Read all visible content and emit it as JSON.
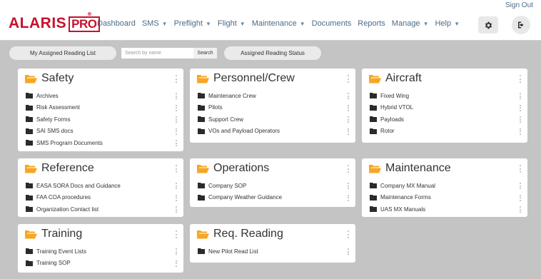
{
  "header": {
    "logo_main": "ALARIS",
    "logo_pro": "PRO",
    "logo_reg": "®",
    "nav": [
      {
        "label": "Dashboard",
        "dropdown": false
      },
      {
        "label": "SMS",
        "dropdown": true
      },
      {
        "label": "Preflight",
        "dropdown": true
      },
      {
        "label": "Flight",
        "dropdown": true
      },
      {
        "label": "Maintenance",
        "dropdown": true
      },
      {
        "label": "Documents",
        "dropdown": false
      },
      {
        "label": "Reports",
        "dropdown": false
      },
      {
        "label": "Manage",
        "dropdown": true
      },
      {
        "label": "Help",
        "dropdown": true
      }
    ],
    "sign_out": "Sign Out"
  },
  "toolbar": {
    "my_reading_list": "My Assigned Reading List",
    "search_placeholder": "Search by name",
    "search_button": "Search",
    "reading_status": "Assigned Reading Status"
  },
  "colors": {
    "brand_red": "#c8102e",
    "folder_orange": "#f5a623",
    "folder_dark": "#2b2b2b",
    "nav_blue": "#4a6a8a"
  },
  "cards": [
    {
      "title": "Safety",
      "items": [
        "Archives",
        "Risk Assessment",
        "Safety Forms",
        "SAI SMS docs",
        "SMS Program Documents"
      ]
    },
    {
      "title": "Personnel/Crew",
      "items": [
        "Maintenance Crew",
        "Pilots",
        "Support Crew",
        "VOs and Payload Operators"
      ]
    },
    {
      "title": "Aircraft",
      "items": [
        "Fixed Wing",
        "Hybrid VTOL",
        "Payloads",
        "Rotor"
      ]
    },
    {
      "title": "Reference",
      "items": [
        "EASA SORA Docs and Guidance",
        "FAA COA procedures",
        "Organization Contact list"
      ]
    },
    {
      "title": "Operations",
      "items": [
        "Company SOP",
        "Company Weather Guidance"
      ]
    },
    {
      "title": "Maintenance",
      "items": [
        "Company MX Manual",
        "Maintenance Forms",
        "UAS MX Manuals"
      ]
    },
    {
      "title": "Training",
      "items": [
        "Training Event Lists",
        "Training SOP"
      ]
    },
    {
      "title": "Req. Reading",
      "items": [
        "New Pilot Read List"
      ]
    }
  ]
}
